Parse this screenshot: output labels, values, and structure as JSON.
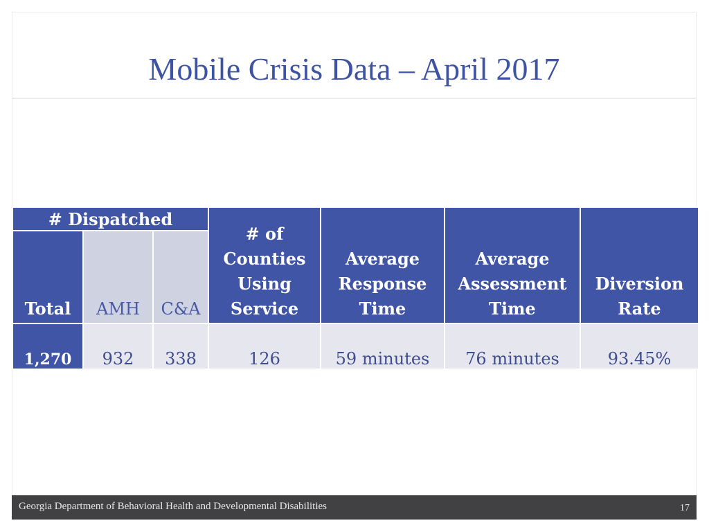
{
  "slide": {
    "title": "Mobile Crisis Data – April 2017",
    "footer": "Georgia Department of Behavioral Health and Developmental Disabilities",
    "page_number": "17"
  },
  "table": {
    "group_header": "# Dispatched",
    "headers": {
      "total": "Total",
      "amh": "AMH",
      "ca": "C&A",
      "counties": [
        "# of",
        "Counties",
        "Using",
        "Service"
      ],
      "response": [
        "Average",
        "Response",
        "Time"
      ],
      "assessment": [
        "Average",
        "Assessment",
        "Time"
      ],
      "diversion": [
        "Diversion",
        "Rate"
      ]
    },
    "values": {
      "total": "1,270",
      "amh": "932",
      "ca": "338",
      "counties": "126",
      "response": "59 minutes",
      "assessment": "76 minutes",
      "diversion": "93.45%"
    }
  },
  "colors": {
    "header_blue": "#4155a6",
    "sub_header_gray": "#cfd3e1",
    "value_cell_gray": "#e6e7ee",
    "title_blue": "#3e54a3",
    "footer_bg": "#414042"
  }
}
